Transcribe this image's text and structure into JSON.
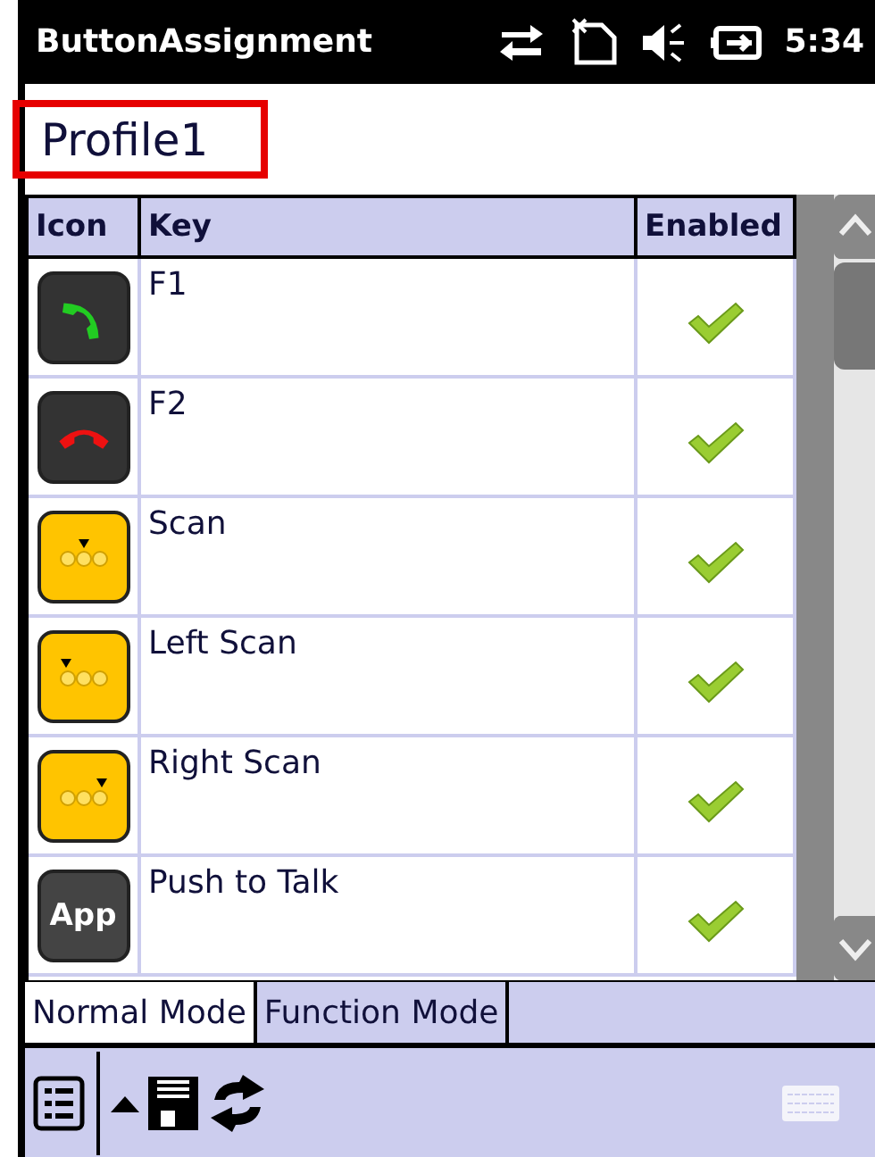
{
  "title_bar": {
    "title": "ButtonAssignment",
    "time": "5:34"
  },
  "profile": {
    "name": "Profile1"
  },
  "table": {
    "columns": [
      "Icon",
      "Key",
      "Enabled"
    ],
    "rows": [
      {
        "icon": {
          "kind": "green-phone"
        },
        "key": "F1",
        "enabled": true
      },
      {
        "icon": {
          "kind": "red-phone"
        },
        "key": "F2",
        "enabled": true
      },
      {
        "icon": {
          "kind": "scan-center"
        },
        "key": "Scan",
        "enabled": true
      },
      {
        "icon": {
          "kind": "scan-left"
        },
        "key": "Left Scan",
        "enabled": true
      },
      {
        "icon": {
          "kind": "scan-right"
        },
        "key": "Right Scan",
        "enabled": true
      },
      {
        "icon": {
          "kind": "app",
          "label": "App"
        },
        "key": "Push to Talk",
        "enabled": true
      }
    ]
  },
  "tabs": [
    {
      "label": "Normal Mode",
      "selected": true
    },
    {
      "label": "Function Mode",
      "selected": false
    }
  ]
}
